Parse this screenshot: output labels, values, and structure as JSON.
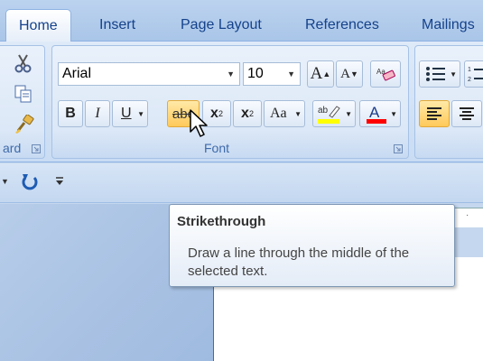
{
  "tabs": [
    {
      "label": "Home"
    },
    {
      "label": "Insert"
    },
    {
      "label": "Page Layout"
    },
    {
      "label": "References"
    },
    {
      "label": "Mailings"
    }
  ],
  "ribbon": {
    "clipboard_label_partial": "ard",
    "font_group_label": "Font",
    "font_name": "Arial",
    "font_size": "10",
    "buttons": {
      "bold": "B",
      "italic": "I",
      "underline": "U",
      "strike": "abc",
      "subscript": "x",
      "superscript": "x",
      "case": "Aa",
      "grow": "A",
      "shrink": "A"
    },
    "colors": {
      "highlight": "#ffff00",
      "font_color": "#ff0000",
      "accent": "#15428b"
    }
  },
  "tooltip": {
    "title": "Strikethrough",
    "body": "Draw a line through the middle of the selected text."
  }
}
